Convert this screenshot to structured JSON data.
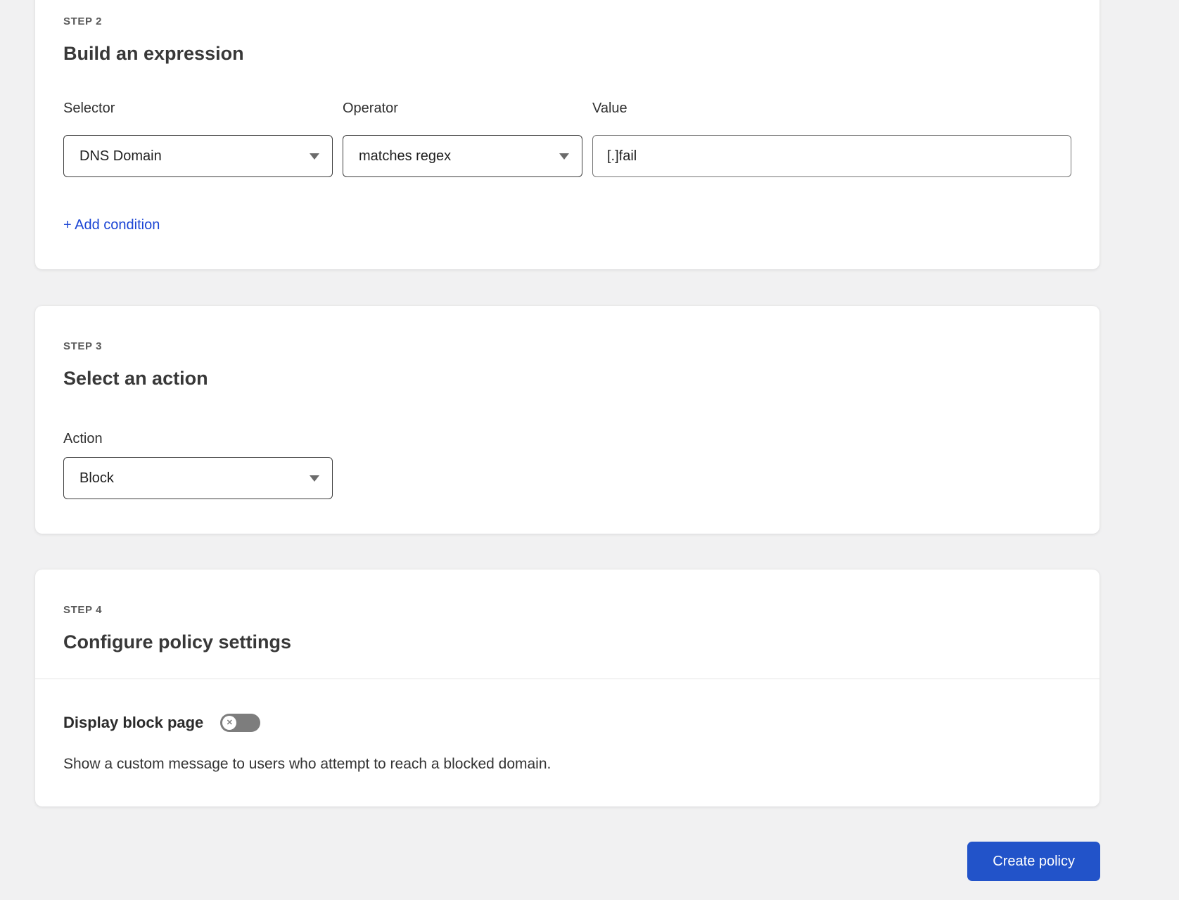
{
  "step2": {
    "step_label": "STEP 2",
    "title": "Build an expression",
    "selector": {
      "label": "Selector",
      "value": "DNS Domain"
    },
    "operator": {
      "label": "Operator",
      "value": "matches regex"
    },
    "value_field": {
      "label": "Value",
      "value": "[.]fail"
    },
    "add_condition_label": "+ Add condition"
  },
  "step3": {
    "step_label": "STEP 3",
    "title": "Select an action",
    "action": {
      "label": "Action",
      "value": "Block"
    }
  },
  "step4": {
    "step_label": "STEP 4",
    "title": "Configure policy settings",
    "display_block_page": {
      "label": "Display block page",
      "toggle_state": "off",
      "toggle_knob_glyph": "✕",
      "description": "Show a custom message to users who attempt to reach a blocked domain."
    }
  },
  "footer": {
    "create_policy_label": "Create policy"
  },
  "colors": {
    "background": "#f1f1f2",
    "card": "#ffffff",
    "link_blue": "#1b45d4",
    "button_blue": "#2253c9",
    "toggle_off_gray": "#7d7d7d",
    "step_label_gray": "#595959",
    "heading_gray": "#383838",
    "control_border_dark": "#3d3d3d",
    "input_border_gray": "#757575",
    "divider": "#e5e5e5"
  }
}
